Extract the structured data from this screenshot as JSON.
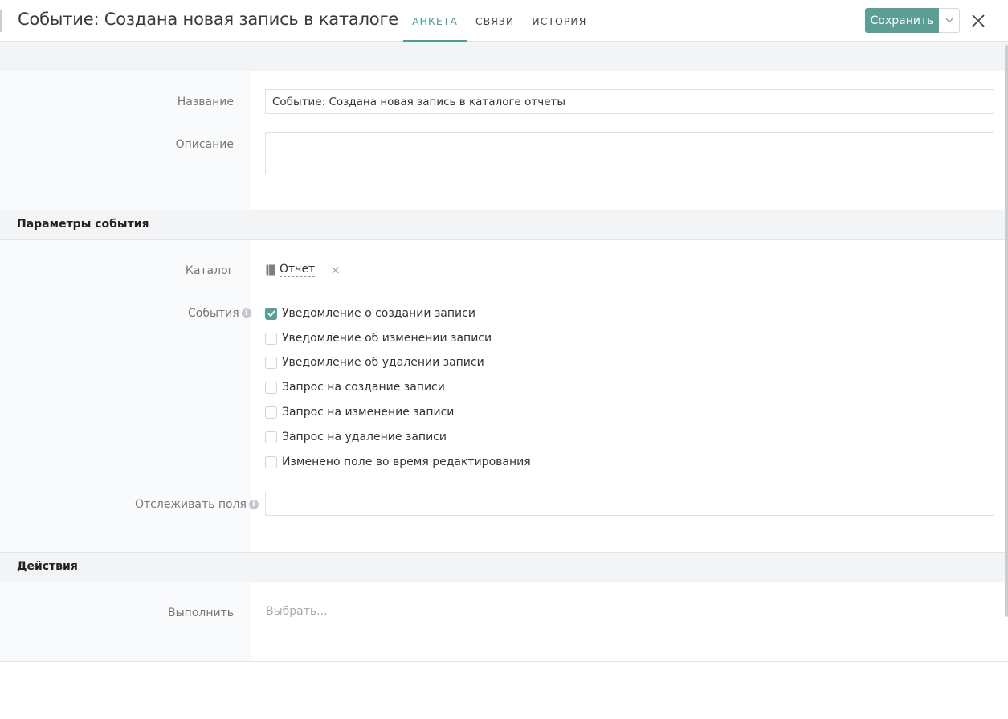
{
  "header": {
    "title": "Событие: Создана новая запись в каталоге",
    "tabs": [
      {
        "label": "АНКЕТА",
        "active": true
      },
      {
        "label": "СВЯЗИ",
        "active": false
      },
      {
        "label": "ИСТОРИЯ",
        "active": false
      }
    ],
    "save_label": "Сохранить",
    "accent_color": "#5a9e94"
  },
  "form": {
    "name_label": "Название",
    "name_value": "Событие: Создана новая запись в каталоге отчеты",
    "description_label": "Описание",
    "description_value": ""
  },
  "event_params": {
    "section_title": "Параметры события",
    "catalog_label": "Каталог",
    "catalog_value": "Отчет",
    "events_label": "События",
    "events": [
      {
        "label": "Уведомление о создании записи",
        "checked": true
      },
      {
        "label": "Уведомление об изменении записи",
        "checked": false
      },
      {
        "label": "Уведомление об удалении записи",
        "checked": false
      },
      {
        "label": "Запрос на создание записи",
        "checked": false
      },
      {
        "label": "Запрос на изменение записи",
        "checked": false
      },
      {
        "label": "Запрос на удаление записи",
        "checked": false
      },
      {
        "label": "Изменено поле во время редактирования",
        "checked": false
      }
    ],
    "track_fields_label": "Отслеживать поля",
    "track_fields_value": ""
  },
  "actions": {
    "section_title": "Действия",
    "execute_label": "Выполнить",
    "execute_placeholder": "Выбрать..."
  }
}
